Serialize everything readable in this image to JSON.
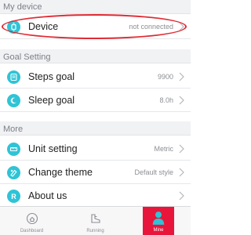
{
  "sections": {
    "my_device": "My device",
    "goal_setting": "Goal Setting",
    "more": "More"
  },
  "device_row": {
    "label": "Device",
    "value": "not connected",
    "icon": "watch-icon"
  },
  "goals": [
    {
      "label": "Steps goal",
      "value": "9900",
      "icon": "steps-icon"
    },
    {
      "label": "Sleep goal",
      "value": "8.0h",
      "icon": "sleep-icon"
    }
  ],
  "more_items": [
    {
      "label": "Unit setting",
      "value": "Metric",
      "icon": "ruler-icon"
    },
    {
      "label": "Change theme",
      "value": "Default style",
      "icon": "theme-icon"
    },
    {
      "label": "About us",
      "value": "",
      "icon": "info-icon"
    }
  ],
  "tabs": [
    {
      "label": "Dashboard",
      "icon": "home-icon",
      "active": false
    },
    {
      "label": "Running",
      "icon": "running-shoe-icon",
      "active": false
    },
    {
      "label": "Mine",
      "icon": "person-icon",
      "active": true
    }
  ],
  "colors": {
    "accent_teal": "#2ec4d6",
    "active_tab": "#e9163b",
    "highlight_ring": "#e02b34"
  }
}
